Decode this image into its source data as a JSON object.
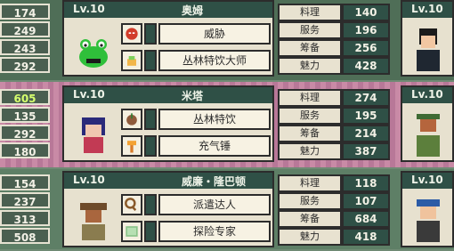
{
  "left_stats": [
    [
      "174",
      "249",
      "243",
      "292"
    ],
    [
      "605",
      "135",
      "292",
      "180"
    ],
    [
      "154",
      "237",
      "313",
      "508"
    ]
  ],
  "staff": [
    {
      "level": "Lv.10",
      "name": "奥姆",
      "skills": [
        {
          "icon": "angry-face-icon",
          "label": "威胁"
        },
        {
          "icon": "jungle-food-icon",
          "label": "丛林特饮大师"
        }
      ],
      "stats": [
        {
          "label": "料理",
          "value": "140"
        },
        {
          "label": "服务",
          "value": "196"
        },
        {
          "label": "筹备",
          "value": "256"
        },
        {
          "label": "魅力",
          "value": "428"
        }
      ],
      "right_level": "Lv.10"
    },
    {
      "level": "Lv.10",
      "name": "米塔",
      "skills": [
        {
          "icon": "coconut-drink-icon",
          "label": "丛林特饮"
        },
        {
          "icon": "hammer-icon",
          "label": "充气锤"
        }
      ],
      "stats": [
        {
          "label": "料理",
          "value": "274"
        },
        {
          "label": "服务",
          "value": "195"
        },
        {
          "label": "筹备",
          "value": "214"
        },
        {
          "label": "魅力",
          "value": "387"
        }
      ],
      "right_level": "Lv.10"
    },
    {
      "level": "Lv.10",
      "name": "威廉・隆巴顿",
      "skills": [
        {
          "icon": "magnifier-icon",
          "label": "派遣达人"
        },
        {
          "icon": "map-icon",
          "label": "探险专家"
        }
      ],
      "stats": [
        {
          "label": "料理",
          "value": "118"
        },
        {
          "label": "服务",
          "value": "107"
        },
        {
          "label": "筹备",
          "value": "684"
        },
        {
          "label": "魅力",
          "value": "418"
        }
      ],
      "right_level": "Lv.10"
    }
  ]
}
